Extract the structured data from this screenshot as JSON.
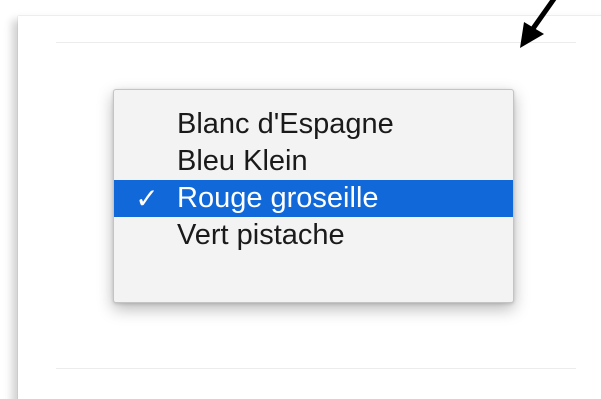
{
  "menu": {
    "items": [
      {
        "label": "Blanc d'Espagne",
        "checked": false,
        "highlighted": false
      },
      {
        "label": "Bleu Klein",
        "checked": false,
        "highlighted": false
      },
      {
        "label": "Rouge groseille",
        "checked": true,
        "highlighted": true
      },
      {
        "label": "Vert pistache",
        "checked": false,
        "highlighted": false
      }
    ],
    "check_glyph": "✓"
  },
  "colors": {
    "highlight": "#1168d9",
    "menu_background": "#f3f3f3"
  }
}
